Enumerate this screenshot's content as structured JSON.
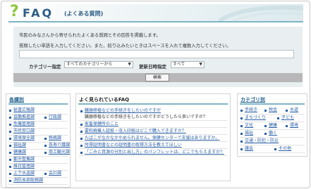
{
  "header": {
    "mark": "?",
    "title": "FAQ",
    "subtitle": "(よくある質問)"
  },
  "search": {
    "intro": "市民のみなさんから寄せられたよくある質問とその回答を掲載します。",
    "instruction": "質問したい単語を入力してください。また、絞り込みたいときはスペースを入れて複数入力してください。",
    "keyword_value": "",
    "category_label": "カテゴリー指定",
    "category_value": "すべてのカテゴリーから",
    "update_label": "更新日時指定",
    "update_value": "すべて",
    "button_label": "検索"
  },
  "departments": {
    "heading": "各課別",
    "items": [
      [
        "秘書広報課"
      ],
      [
        "協働推進課",
        "行政課"
      ],
      [
        "危機管理課"
      ],
      [
        "市民窓口課"
      ],
      [
        "環境保全課",
        "税務課"
      ],
      [
        "福祉課",
        "長寿介護課"
      ],
      [
        "健康課",
        "商工観光課"
      ],
      [
        "都市整備課"
      ],
      [
        "維持管理課"
      ],
      [
        "上下水道課",
        "会計課"
      ],
      [
        "消防本部総務課"
      ]
    ]
  },
  "popular": {
    "heading": "よく見られているFAQ",
    "items": [
      {
        "q": "臓器移植などの手続きをしたいのですが",
        "sub": "臓器移植などの手続きをしたいのですがどうしたら良いですか？"
      },
      {
        "q": "家畜保健所のこと"
      },
      {
        "q": "要和廃棄入証紙・収入印紙はどこで購入できますか？"
      },
      {
        "q": "たばこがなかなかやめられません。保健センターで支援はありますか。"
      },
      {
        "q": "所得証明書などの証明書の取得方法を教えてほしい"
      },
      {
        "q": "「ごみと資源の分別と出し方」のパンフレットは、どこでもらえますか？"
      }
    ]
  },
  "categories": {
    "heading": "カテゴリ別",
    "rows": [
      [
        "手続き",
        "税金",
        "水道"
      ],
      [
        "まちづくり",
        "子ども"
      ],
      [
        "文化",
        "健康",
        "環境"
      ],
      [
        "福祉",
        "働く"
      ],
      [
        "交通・防犯・防災"
      ],
      [
        "議会",
        "その他"
      ]
    ]
  },
  "colors": {
    "accent": "#2d5d86",
    "mark": "#8dc63f",
    "rule": "#7fb4c4",
    "panel": "#e9eff1",
    "link": "#2a5fa5"
  }
}
